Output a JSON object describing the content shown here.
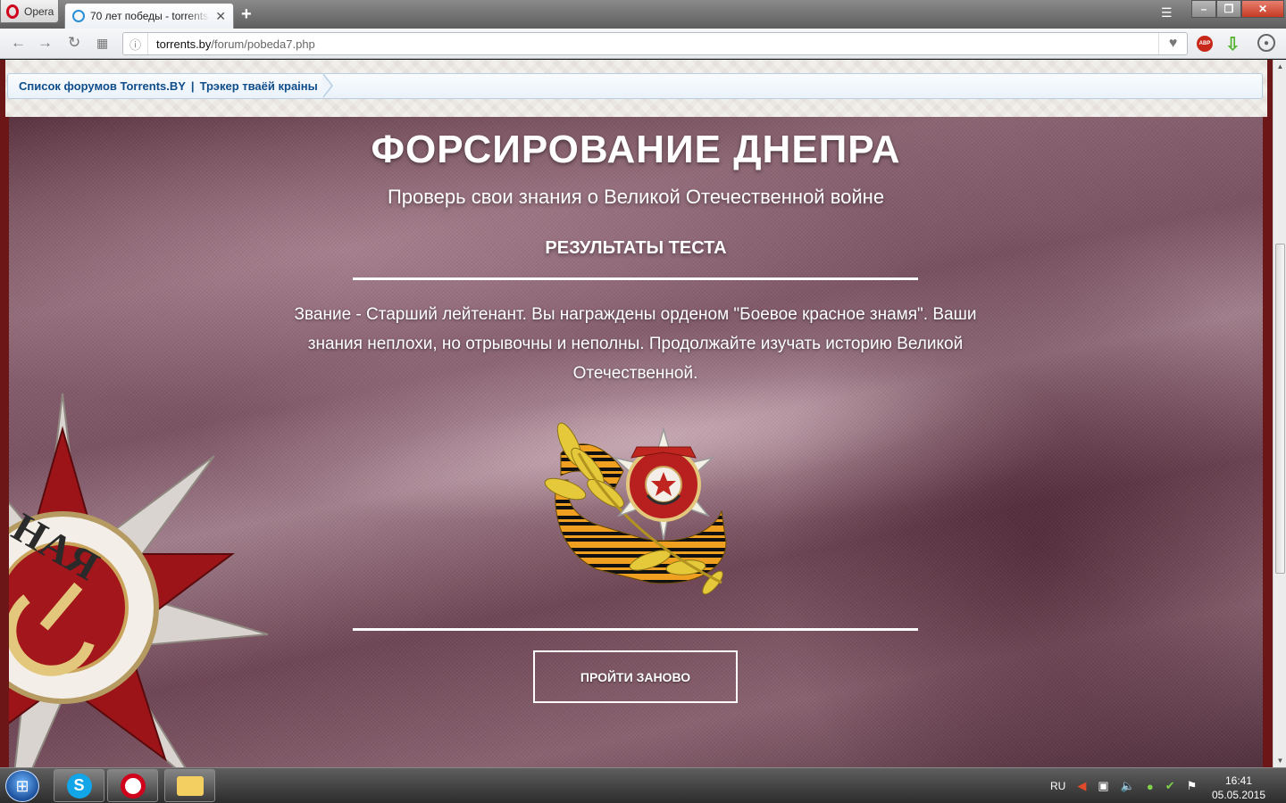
{
  "browser": {
    "menu_label": "Opera",
    "tab_title": "70 лет победы - torrents.by",
    "url_domain": "torrents.by",
    "url_path": "/forum/pobeda7.php"
  },
  "breadcrumb": {
    "link1": "Список форумов Torrents.BY",
    "separator": "|",
    "link2": "Трэкер тваёй краіны"
  },
  "quiz": {
    "title": "ФОРСИРОВАНИЕ ДНЕПРА",
    "subtitle": "Проверь свои знания о Великой Отечественной войне",
    "results_heading": "РЕЗУЛЬТАТЫ ТЕСТА",
    "result_text": "Звание - Старший лейтенант. Вы награждены орденом \"Боевое красное знамя\". Ваши знания неплохи, но отрывочны и неполны. Продолжайте изучать историю Великой Отечественной.",
    "retry_label": "ПРОЙТИ ЗАНОВО",
    "medal_icon": "order-of-the-red-banner-icon",
    "background_order_icon": "order-of-patriotic-war-icon"
  },
  "taskbar": {
    "language": "RU",
    "time": "16:41",
    "date": "05.05.2015",
    "apps": [
      "skype-icon",
      "opera-icon",
      "explorer-folder-icon"
    ]
  },
  "colors": {
    "breadcrumb_link": "#0e4d8a",
    "page_frame": "#6d1617",
    "hero_base": "#7b5363"
  }
}
